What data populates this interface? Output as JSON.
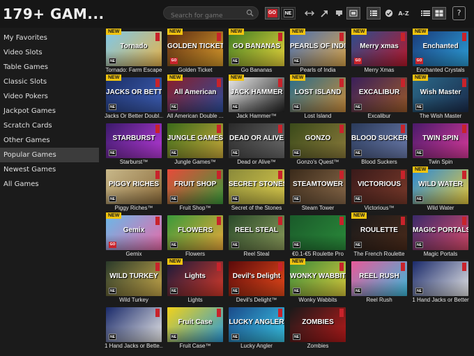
{
  "header": {
    "title": "179+ GAM...",
    "search_placeholder": "Search for game",
    "filter_go": "GO",
    "filter_ne": "NE",
    "sort_az": "A-Z",
    "help": "?"
  },
  "sidebar": {
    "items": [
      {
        "label": "My Favorites"
      },
      {
        "label": "Video Slots"
      },
      {
        "label": "Table Games"
      },
      {
        "label": "Classic Slots"
      },
      {
        "label": "Video Pokers"
      },
      {
        "label": "Jackpot Games"
      },
      {
        "label": "Scratch Cards"
      },
      {
        "label": "Other Games"
      },
      {
        "label": "Popular Games",
        "active": true
      },
      {
        "label": "Newest Games"
      },
      {
        "label": "All Games"
      }
    ]
  },
  "badges": {
    "new": "NEW",
    "go": "GO",
    "ne": "NE"
  },
  "games": [
    {
      "name": "Tornado: Farm Escape",
      "isNew": true,
      "vendor": "NE",
      "colors": [
        "#7fc8e8",
        "#e5b24a"
      ],
      "logo": "Tornado"
    },
    {
      "name": "Golden Ticket",
      "isNew": true,
      "vendor": "GO",
      "colors": [
        "#5a2a12",
        "#d79b2b"
      ],
      "logo": "GOLDEN TICKET"
    },
    {
      "name": "Go Bananas",
      "isNew": true,
      "vendor": "NE",
      "colors": [
        "#3f7d23",
        "#e8d33a"
      ],
      "logo": "GO BANANAS"
    },
    {
      "name": "Pearls of India",
      "isNew": true,
      "vendor": "NE",
      "colors": [
        "#4a6fb0",
        "#d8a44a"
      ],
      "logo": "PEARLS OF INDIA"
    },
    {
      "name": "Merry Xmas",
      "isNew": true,
      "vendor": "GO",
      "colors": [
        "#2b4d8e",
        "#b8182a"
      ],
      "logo": "Merry xmas"
    },
    {
      "name": "Enchanted Crystals",
      "isNew": true,
      "vendor": "GO",
      "colors": [
        "#1a3b7a",
        "#2c9fd8"
      ],
      "logo": "Enchanted"
    },
    {
      "name": "Jacks Or Better Doubl...",
      "isNew": true,
      "vendor": "NE",
      "colors": [
        "#1c2f66",
        "#3d5eb4"
      ],
      "logo": "JACKS OR BETTER"
    },
    {
      "name": "All American Double ...",
      "isNew": true,
      "vendor": "NE",
      "colors": [
        "#8a1d2a",
        "#2c4d9a"
      ],
      "logo": "All American"
    },
    {
      "name": "Jack Hammer™",
      "isNew": true,
      "vendor": "NE",
      "colors": [
        "#e8e8e8",
        "#222222"
      ],
      "logo": "JACK HAMMER"
    },
    {
      "name": "Lost Island",
      "isNew": true,
      "vendor": "NE",
      "colors": [
        "#2a6e8a",
        "#c88a3a"
      ],
      "logo": "LOST ISLAND"
    },
    {
      "name": "Excalibur",
      "isNew": false,
      "vendor": "NE",
      "colors": [
        "#3a1f5a",
        "#9a5a2a"
      ],
      "logo": "EXCALIBUR"
    },
    {
      "name": "The Wish Master",
      "isNew": true,
      "vendor": "NE",
      "colors": [
        "#2b6a8a",
        "#1a2b4a"
      ],
      "logo": "Wish Master"
    },
    {
      "name": "Starburst™",
      "isNew": false,
      "vendor": "NE",
      "colors": [
        "#3a1a6a",
        "#b83ad8"
      ],
      "logo": "STARBURST"
    },
    {
      "name": "Jungle Games™",
      "isNew": false,
      "vendor": "NE",
      "colors": [
        "#3a6a1a",
        "#c8a83a"
      ],
      "logo": "JUNGLE GAMES"
    },
    {
      "name": "Dead or Alive™",
      "isNew": false,
      "vendor": "NE",
      "colors": [
        "#2a2a2a",
        "#6a6a6a"
      ],
      "logo": "DEAD OR ALIVE"
    },
    {
      "name": "Gonzo's Quest™",
      "isNew": false,
      "vendor": "NE",
      "colors": [
        "#3a4a1a",
        "#8a7a3a"
      ],
      "logo": "GONZO"
    },
    {
      "name": "Blood Suckers",
      "isNew": false,
      "vendor": "NE",
      "colors": [
        "#2a3a5a",
        "#6a7aaa"
      ],
      "logo": "BLOOD SUCKERS"
    },
    {
      "name": "Twin Spin",
      "isNew": false,
      "vendor": "NE",
      "colors": [
        "#4a1a6a",
        "#d83a9a"
      ],
      "logo": "TWIN SPIN"
    },
    {
      "name": "Piggy Riches™",
      "isNew": false,
      "vendor": "NE",
      "colors": [
        "#c8b88a",
        "#8a6a3a"
      ],
      "logo": "PIGGY RICHES"
    },
    {
      "name": "Fruit Shop™",
      "isNew": false,
      "vendor": "NE",
      "colors": [
        "#e84a3a",
        "#3a9a3a"
      ],
      "logo": "FRUIT SHOP"
    },
    {
      "name": "Secret of the Stones",
      "isNew": false,
      "vendor": "NE",
      "colors": [
        "#8a8a3a",
        "#d8c84a"
      ],
      "logo": "SECRET STONES"
    },
    {
      "name": "Steam Tower",
      "isNew": false,
      "vendor": "NE",
      "colors": [
        "#3a2a1a",
        "#8a6a4a"
      ],
      "logo": "STEAMTOWER"
    },
    {
      "name": "Victorious™",
      "isNew": false,
      "vendor": "NE",
      "colors": [
        "#3a1a1a",
        "#7a3a2a"
      ],
      "logo": "VICTORIOUS"
    },
    {
      "name": "Wild Water",
      "isNew": true,
      "vendor": "NE",
      "colors": [
        "#2a8ad8",
        "#e8c83a"
      ],
      "logo": "WILD WATER"
    },
    {
      "name": "Gemix",
      "isNew": true,
      "vendor": "GO",
      "colors": [
        "#6ab8e8",
        "#e86aa8"
      ],
      "logo": "Gemix"
    },
    {
      "name": "Flowers",
      "isNew": false,
      "vendor": "NE",
      "colors": [
        "#3a9a3a",
        "#e8a83a"
      ],
      "logo": "FLOWERS"
    },
    {
      "name": "Reel Steal",
      "isNew": false,
      "vendor": "NE",
      "colors": [
        "#2a4a2a",
        "#8a9a5a"
      ],
      "logo": "REEL STEAL"
    },
    {
      "name": "€0.1-€5 Roulette Pro",
      "isNew": false,
      "vendor": "NE",
      "colors": [
        "#1a5a2a",
        "#2a8a3a"
      ],
      "logo": ""
    },
    {
      "name": "The French Roulette",
      "isNew": true,
      "vendor": "NE",
      "colors": [
        "#1a1a1a",
        "#4a2a1a"
      ],
      "logo": "ROULETTE"
    },
    {
      "name": "Magic Portals",
      "isNew": false,
      "vendor": "NE",
      "colors": [
        "#3a2a6a",
        "#d84a6a"
      ],
      "logo": "MAGIC PORTALS"
    },
    {
      "name": "Wild Turkey",
      "isNew": false,
      "vendor": "NE",
      "colors": [
        "#2a3a2a",
        "#c8a84a"
      ],
      "logo": "WILD TURKEY"
    },
    {
      "name": "Lights",
      "isNew": true,
      "vendor": "NE",
      "colors": [
        "#1a1a3a",
        "#d83a2a"
      ],
      "logo": "Lights"
    },
    {
      "name": "Devil's Delight™",
      "isNew": false,
      "vendor": "NE",
      "colors": [
        "#5a0a0a",
        "#e84a1a"
      ],
      "logo": "Devil's Delight"
    },
    {
      "name": "Wonky Wabbits",
      "isNew": true,
      "vendor": "NE",
      "colors": [
        "#3a8a3a",
        "#d8c83a"
      ],
      "logo": "WONKY WABBITS"
    },
    {
      "name": "Reel Rush",
      "isNew": false,
      "vendor": "NE",
      "colors": [
        "#e85a9a",
        "#3ab8d8"
      ],
      "logo": "REEL RUSH"
    },
    {
      "name": "1 Hand Jacks or Better",
      "isNew": false,
      "vendor": "NE",
      "colors": [
        "#1a2a6a",
        "#e8e8e8"
      ],
      "logo": ""
    },
    {
      "name": "1 Hand Jacks or Bette...",
      "isNew": false,
      "vendor": "NE",
      "colors": [
        "#1a2a6a",
        "#e8e8e8"
      ],
      "logo": ""
    },
    {
      "name": "Fruit Case™",
      "isNew": false,
      "vendor": "NE",
      "colors": [
        "#f2d21a",
        "#2a9ad8"
      ],
      "logo": "Fruit Case"
    },
    {
      "name": "Lucky Angler",
      "isNew": false,
      "vendor": "NE",
      "colors": [
        "#1a4a8a",
        "#3ac8e8"
      ],
      "logo": "LUCKY ANGLER"
    },
    {
      "name": "Zombies",
      "isNew": false,
      "vendor": "NE",
      "colors": [
        "#1a1a1a",
        "#b81a1a"
      ],
      "logo": "ZOMBIES"
    }
  ]
}
